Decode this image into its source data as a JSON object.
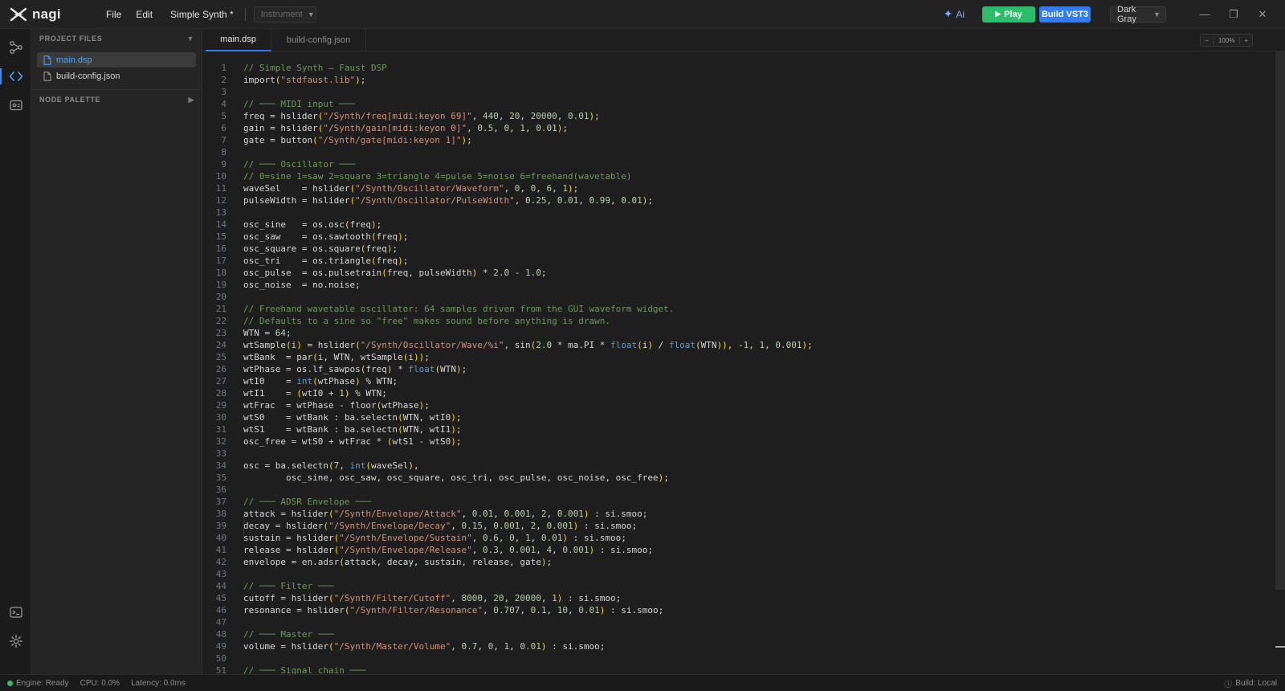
{
  "app": {
    "name": "nagi",
    "menu": [
      "File",
      "Edit"
    ],
    "project_title": "Simple Synth *",
    "type_select": "Instrument",
    "ai_label": "Ai",
    "play_label": "Play",
    "build_label": "Build VST3",
    "theme_select": "Dark Gray",
    "colors": {
      "play": "#2bbd6a",
      "build": "#2f7cf6",
      "accent": "#3a8cff"
    }
  },
  "activity_bar": {
    "icons": [
      "node-graph-icon",
      "code-icon",
      "preview-icon",
      "terminal-icon",
      "settings-icon"
    ],
    "active": "code-icon"
  },
  "sidebar": {
    "project_files_label": "PROJECT FILES",
    "node_palette_label": "NODE PALETTE",
    "files": [
      "main.dsp",
      "build-config.json"
    ],
    "active_file": "main.dsp"
  },
  "editor": {
    "tabs": [
      "main.dsp",
      "build-config.json"
    ],
    "active_tab": "main.dsp",
    "zoom": {
      "minus": "−",
      "value": "100%",
      "plus": "+"
    }
  },
  "code": [
    "// Simple Synth — Faust DSP",
    "import(\"stdfaust.lib\");",
    "",
    "// ─── MIDI input ───",
    "freq = hslider(\"/Synth/freq[midi:keyon 69]\", 440, 20, 20000, 0.01);",
    "gain = hslider(\"/Synth/gain[midi:keyon 0]\", 0.5, 0, 1, 0.01);",
    "gate = button(\"/Synth/gate[midi:keyon 1]\");",
    "",
    "// ─── Oscillator ───",
    "// 0=sine 1=saw 2=square 3=triangle 4=pulse 5=noise 6=freehand(wavetable)",
    "waveSel    = hslider(\"/Synth/Oscillator/Waveform\", 0, 0, 6, 1);",
    "pulseWidth = hslider(\"/Synth/Oscillator/PulseWidth\", 0.25, 0.01, 0.99, 0.01);",
    "",
    "osc_sine   = os.osc(freq);",
    "osc_saw    = os.sawtooth(freq);",
    "osc_square = os.square(freq);",
    "osc_tri    = os.triangle(freq);",
    "osc_pulse  = os.pulsetrain(freq, pulseWidth) * 2.0 - 1.0;",
    "osc_noise  = no.noise;",
    "",
    "// Freehand wavetable oscillator: 64 samples driven from the GUI waveform widget.",
    "// Defaults to a sine so \"free\" makes sound before anything is drawn.",
    "WTN = 64;",
    "wtSample(i) = hslider(\"/Synth/Oscillator/Wave/%i\", sin(2.0 * ma.PI * float(i) / float(WTN)), -1, 1, 0.001);",
    "wtBank  = par(i, WTN, wtSample(i));",
    "wtPhase = os.lf_sawpos(freq) * float(WTN);",
    "wtI0    = int(wtPhase) % WTN;",
    "wtI1    = (wtI0 + 1) % WTN;",
    "wtFrac  = wtPhase - floor(wtPhase);",
    "wtS0    = wtBank : ba.selectn(WTN, wtI0);",
    "wtS1    = wtBank : ba.selectn(WTN, wtI1);",
    "osc_free = wtS0 + wtFrac * (wtS1 - wtS0);",
    "",
    "osc = ba.selectn(7, int(waveSel),",
    "        osc_sine, osc_saw, osc_square, osc_tri, osc_pulse, osc_noise, osc_free);",
    "",
    "// ─── ADSR Envelope ───",
    "attack = hslider(\"/Synth/Envelope/Attack\", 0.01, 0.001, 2, 0.001) : si.smoo;",
    "decay = hslider(\"/Synth/Envelope/Decay\", 0.15, 0.001, 2, 0.001) : si.smoo;",
    "sustain = hslider(\"/Synth/Envelope/Sustain\", 0.6, 0, 1, 0.01) : si.smoo;",
    "release = hslider(\"/Synth/Envelope/Release\", 0.3, 0.001, 4, 0.001) : si.smoo;",
    "envelope = en.adsr(attack, decay, sustain, release, gate);",
    "",
    "// ─── Filter ───",
    "cutoff = hslider(\"/Synth/Filter/Cutoff\", 8000, 20, 20000, 1) : si.smoo;",
    "resonance = hslider(\"/Synth/Filter/Resonance\", 0.707, 0.1, 10, 0.01) : si.smoo;",
    "",
    "// ─── Master ───",
    "volume = hslider(\"/Synth/Master/Volume\", 0.7, 0, 1, 0.01) : si.smoo;",
    "",
    "// ─── Signal chain ───"
  ],
  "status": {
    "engine": "Engine: Ready",
    "cpu": "CPU: 0.0%",
    "latency": "Latency: 0.0ms",
    "build": "Build: Local"
  }
}
